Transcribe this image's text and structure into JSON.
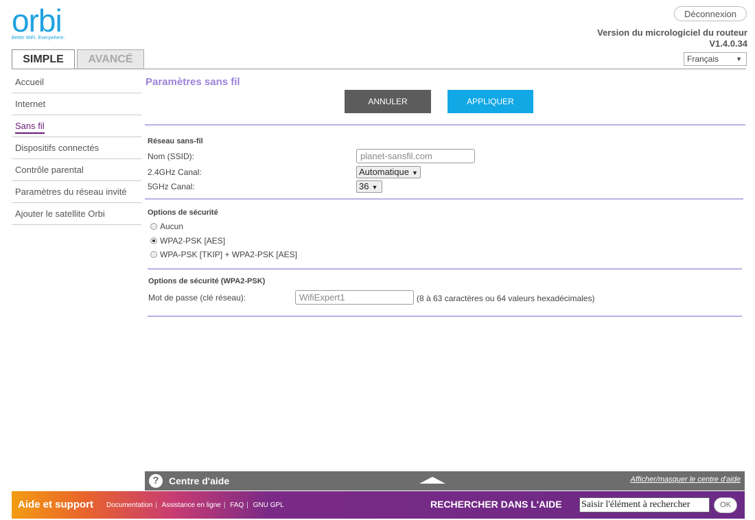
{
  "header": {
    "logo_text": "orbi",
    "logo_tagline": "Better WiFi. Everywhere.",
    "logout_label": "Déconnexion",
    "firmware_label": "Version du micrologiciel du routeur",
    "firmware_version": "V1.4.0.34",
    "language_selected": "Français"
  },
  "tabs": [
    {
      "label": "SIMPLE",
      "active": true
    },
    {
      "label": "AVANCÉ",
      "active": false
    }
  ],
  "sidebar": {
    "items": [
      {
        "label": "Accueil"
      },
      {
        "label": "Internet"
      },
      {
        "label": "Sans fil",
        "active": true
      },
      {
        "label": "Dispositifs connectés"
      },
      {
        "label": "Contrôle parental"
      },
      {
        "label": "Paramètres du réseau invité"
      },
      {
        "label": "Ajouter le satellite Orbi"
      }
    ]
  },
  "main": {
    "title": "Paramètres sans fil",
    "cancel_label": "ANNULER",
    "apply_label": "APPLIQUER",
    "wireless": {
      "section_title": "Réseau sans-fil",
      "ssid_label": "Nom (SSID):",
      "ssid_value": "planet-sansfil.com",
      "channel24_label": "2.4GHz Canal:",
      "channel24_value": "Automatique",
      "channel5_label": "5GHz Canal:",
      "channel5_value": "36"
    },
    "security": {
      "section_title": "Options de sécurité",
      "options": [
        {
          "label": "Aucun",
          "selected": false
        },
        {
          "label": "WPA2-PSK [AES]",
          "selected": true
        },
        {
          "label": "WPA-PSK [TKIP] + WPA2-PSK [AES]",
          "selected": false
        }
      ]
    },
    "wpa2": {
      "section_title": "Options de sécurité (WPA2-PSK)",
      "password_label": "Mot de passe (clé réseau):",
      "password_value": "WifiExpert1",
      "password_hint": "(8 à 63 caractères ou 64 valeurs hexadécimales)"
    }
  },
  "help": {
    "title": "Centre d'aide",
    "toggle_label": "Afficher/masquer le centre d'aide"
  },
  "footer": {
    "title": "Aide et support",
    "links": [
      "Documentation",
      "Assistance en ligne",
      "FAQ",
      "GNU GPL"
    ],
    "search_label": "RECHERCHER DANS L'AIDE",
    "search_value": "Saisir l'élément à rechercher",
    "ok_label": "OK"
  },
  "colors": {
    "accent_blue": "#12a8e6",
    "title_purple": "#9b84d8",
    "divider_lavender": "#b8b0e6",
    "footer_purple": "#6a2a86"
  }
}
